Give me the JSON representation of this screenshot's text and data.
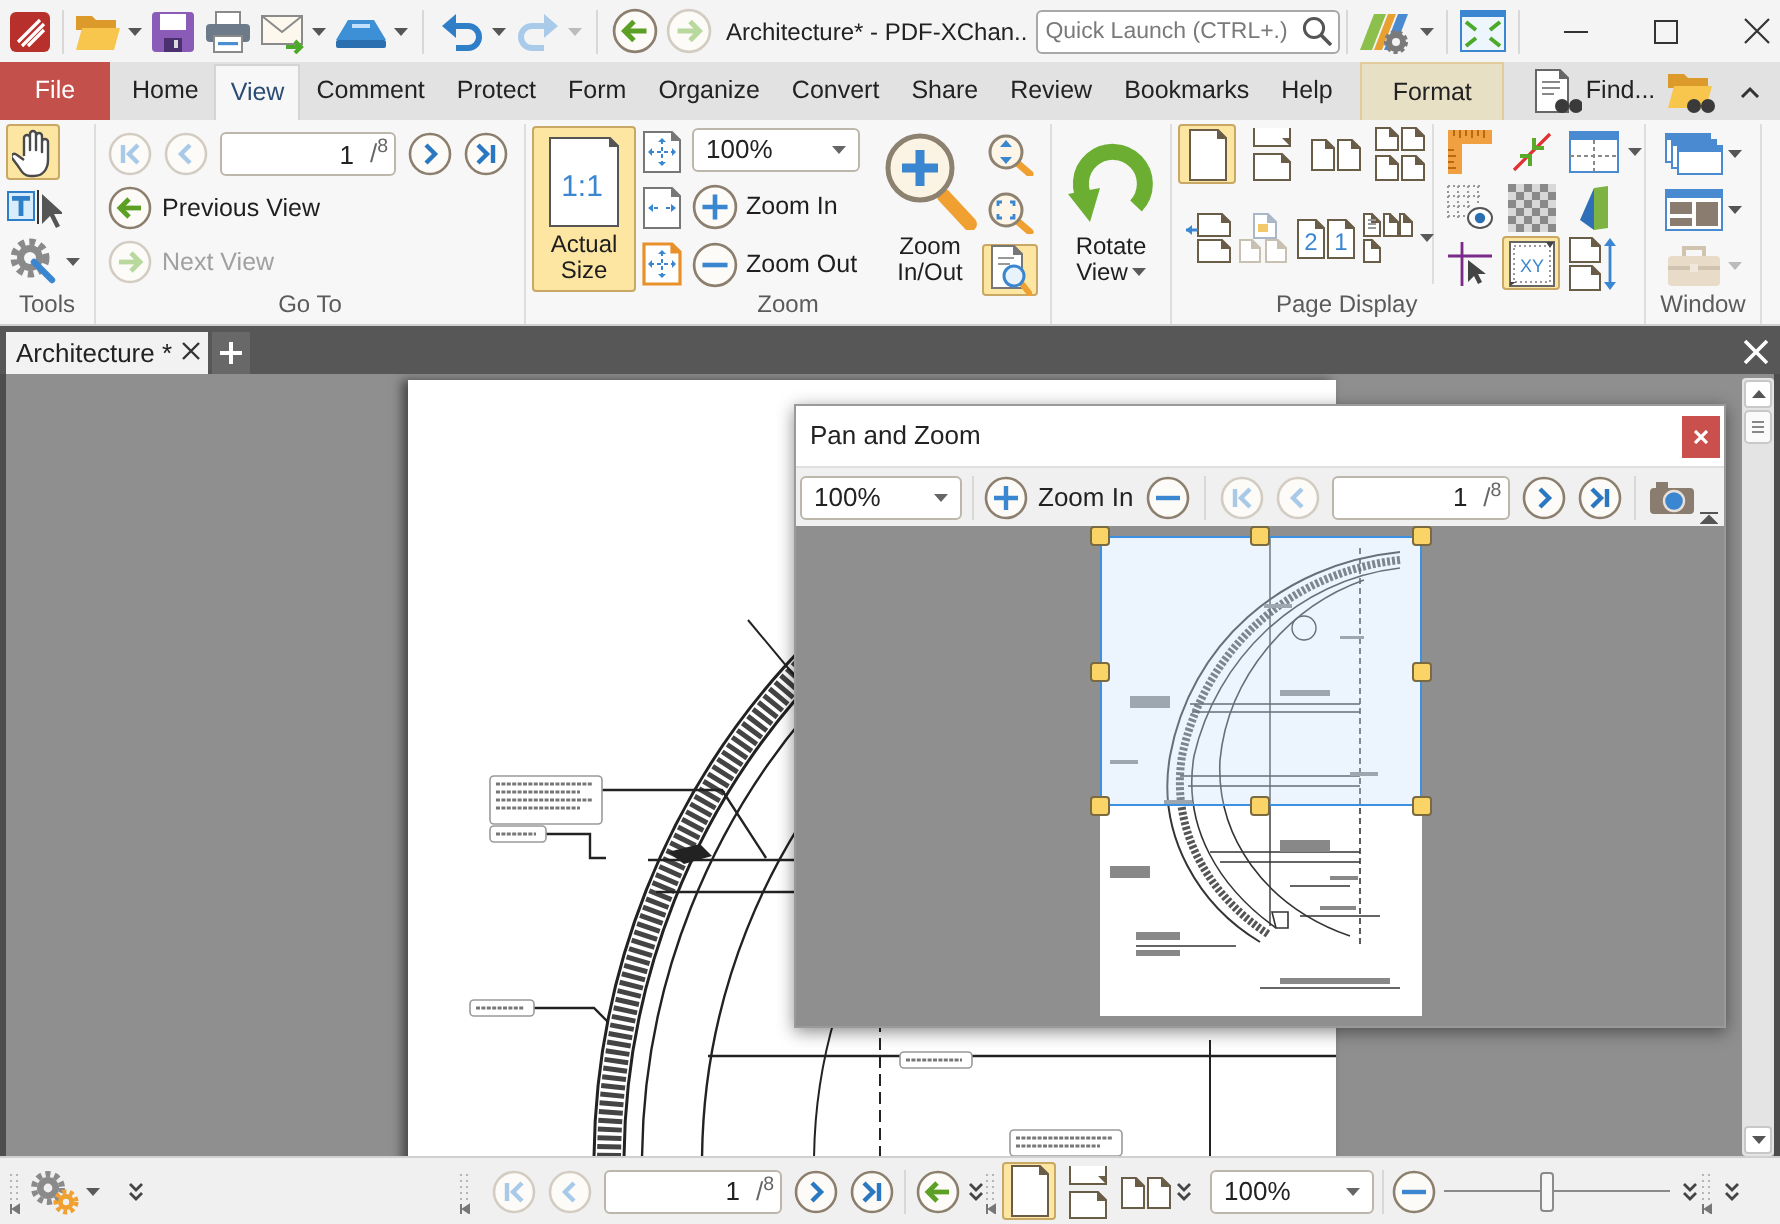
{
  "window": {
    "title": "Architecture* - PDF-XChan..",
    "quick_launch": {
      "placeholder": "Quick Launch (CTRL+.)"
    }
  },
  "quick_access": [
    [
      {
        "kind": "open",
        "dropdown": true,
        "disabled": false
      },
      {
        "kind": "save",
        "dropdown": false,
        "disabled": false
      },
      {
        "kind": "print",
        "dropdown": false,
        "disabled": false
      },
      {
        "kind": "email",
        "dropdown": true,
        "disabled": false
      },
      {
        "kind": "scan",
        "dropdown": true,
        "disabled": false
      }
    ],
    [
      {
        "kind": "undo",
        "dropdown": true,
        "disabled": false
      },
      {
        "kind": "redo",
        "dropdown": true,
        "disabled": true
      }
    ],
    [
      {
        "kind": "back",
        "dropdown": false,
        "disabled": false
      },
      {
        "kind": "forward",
        "dropdown": false,
        "disabled": true
      }
    ]
  ],
  "menu_tabs": [
    {
      "label": "File",
      "kind": "file",
      "selected": false
    },
    {
      "label": "Home",
      "kind": "tab",
      "selected": false
    },
    {
      "label": "View",
      "kind": "tab",
      "selected": true
    },
    {
      "label": "Comment",
      "kind": "tab",
      "selected": false
    },
    {
      "label": "Protect",
      "kind": "tab",
      "selected": false
    },
    {
      "label": "Form",
      "kind": "tab",
      "selected": false
    },
    {
      "label": "Organize",
      "kind": "tab",
      "selected": false
    },
    {
      "label": "Convert",
      "kind": "tab",
      "selected": false
    },
    {
      "label": "Share",
      "kind": "tab",
      "selected": false
    },
    {
      "label": "Review",
      "kind": "tab",
      "selected": false
    },
    {
      "label": "Bookmarks",
      "kind": "tab",
      "selected": false
    },
    {
      "label": "Help",
      "kind": "tab",
      "selected": false
    },
    {
      "label": "Format",
      "kind": "context",
      "selected": false
    }
  ],
  "find": {
    "label": "Find..."
  },
  "ribbon": {
    "tools": {
      "label": "Tools",
      "items": [
        {
          "kind": "hand",
          "selected": true
        },
        {
          "kind": "select_text",
          "selected": false
        },
        {
          "kind": "settings",
          "selected": false
        }
      ]
    },
    "go_to": {
      "label": "Go To",
      "nav": [
        {
          "kind": "first",
          "disabled": true
        },
        {
          "kind": "prev",
          "disabled": true
        },
        {
          "kind": "next",
          "disabled": false
        },
        {
          "kind": "last",
          "disabled": false
        }
      ],
      "page": {
        "value": "1",
        "total": "/$^{8}$"
      },
      "history": [
        {
          "kind": "back",
          "label": "Previous View",
          "disabled": false
        },
        {
          "kind": "forward",
          "label": "Next View",
          "disabled": true
        }
      ]
    },
    "zoom": {
      "label": "Zoom",
      "actual_size": {
        "label": "Actual Size",
        "icon_text": "1:1",
        "selected": true
      },
      "zoom_value": "100%",
      "zoom_buttons": [
        {
          "kind": "plus",
          "label": "Zoom In"
        },
        {
          "kind": "minus",
          "label": "Zoom Out"
        }
      ],
      "zoom_in_out": {
        "label": "Zoom In/Out"
      },
      "tools": [
        {
          "kind": "zoom_height",
          "selected": false
        },
        {
          "kind": "marquee",
          "selected": false
        },
        {
          "kind": "loupe",
          "selected": true
        }
      ]
    },
    "rotate": {
      "label": "Rotate View"
    },
    "page_display": {
      "label": "Page Display",
      "layouts": [
        {
          "kind": "single",
          "selected": true
        },
        {
          "kind": "continuous",
          "selected": false
        },
        {
          "kind": "facing",
          "selected": false
        },
        {
          "kind": "facing_continuous",
          "selected": false
        }
      ],
      "arrange": [
        {
          "kind": "page_arrow",
          "dropdown": false
        },
        {
          "kind": "faded",
          "dropdown": false
        },
        {
          "kind": "numbered",
          "marks": [
            "2",
            "1"
          ],
          "dropdown": false
        },
        {
          "kind": "mixed",
          "dropdown": true
        }
      ],
      "aids": [
        {
          "kind": "ruler",
          "selected": false,
          "dropdown": false
        },
        {
          "kind": "measure",
          "selected": false,
          "dropdown": false
        },
        {
          "kind": "grid",
          "selected": false,
          "dropdown": true
        },
        {
          "kind": "grid_eye",
          "selected": false,
          "dropdown": false
        },
        {
          "kind": "transparency",
          "selected": false,
          "dropdown": false
        },
        {
          "kind": "color",
          "selected": false,
          "dropdown": false
        },
        {
          "kind": "crosshair",
          "selected": false,
          "dropdown": false
        },
        {
          "kind": "coordinates",
          "label": "XY",
          "selected": true,
          "dropdown": false
        },
        {
          "kind": "resize",
          "selected": false,
          "dropdown": false
        }
      ]
    },
    "window": {
      "label": "Window",
      "items": [
        {
          "kind": "cascade",
          "disabled": false
        },
        {
          "kind": "tile",
          "disabled": false
        },
        {
          "kind": "toolbox",
          "disabled": true
        }
      ]
    }
  },
  "documents": {
    "tabs": [
      {
        "label": "Architecture *",
        "selected": true
      }
    ]
  },
  "pan_zoom": {
    "title": "Pan and Zoom",
    "zoom_value": "100%",
    "zoom_in": {
      "label": "Zoom In"
    },
    "nav": [
      {
        "kind": "first",
        "disabled": true
      },
      {
        "kind": "prev",
        "disabled": true
      },
      {
        "kind": "next",
        "disabled": false
      },
      {
        "kind": "last",
        "disabled": false
      }
    ],
    "page": {
      "value": "1",
      "total": "/$^{8}$"
    }
  },
  "status_bar": {
    "nav": [
      {
        "kind": "first",
        "disabled": true
      },
      {
        "kind": "prev",
        "disabled": true
      },
      {
        "kind": "next",
        "disabled": false
      },
      {
        "kind": "last",
        "disabled": false
      }
    ],
    "page": {
      "value": "1",
      "total": "/$^{8}$"
    },
    "back": {
      "disabled": false
    },
    "layouts": [
      {
        "kind": "single",
        "selected": true
      },
      {
        "kind": "continuous",
        "selected": false
      },
      {
        "kind": "facing",
        "selected": false
      }
    ],
    "zoom_value": "100%",
    "zoom_slider": {
      "level": 0.45
    }
  }
}
